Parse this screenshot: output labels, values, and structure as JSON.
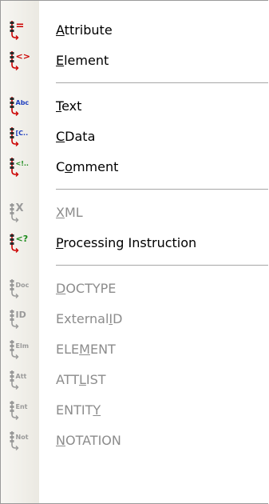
{
  "menu": {
    "items": [
      {
        "label_before": "",
        "accel": "A",
        "label_after": "ttribute",
        "icon": "attribute-icon",
        "badge": "=",
        "enabled": true
      },
      {
        "label_before": "",
        "accel": "E",
        "label_after": "lement",
        "icon": "element-icon",
        "badge": "<>",
        "enabled": true
      },
      {
        "label_before": "",
        "accel": "T",
        "label_after": "ext",
        "icon": "text-icon",
        "badge": "Abc",
        "enabled": true
      },
      {
        "label_before": "",
        "accel": "C",
        "label_after": "Data",
        "icon": "cdata-icon",
        "badge": "[C..",
        "enabled": true
      },
      {
        "label_before": "C",
        "accel": "o",
        "label_after": "mment",
        "icon": "comment-icon",
        "badge": "<!..",
        "enabled": true
      },
      {
        "label_before": "",
        "accel": "X",
        "label_after": "ML",
        "icon": "xml-icon",
        "badge": "X",
        "enabled": false
      },
      {
        "label_before": "",
        "accel": "P",
        "label_after": "rocessing Instruction",
        "icon": "processing-instruction-icon",
        "badge": "<?",
        "enabled": true
      },
      {
        "label_before": "",
        "accel": "D",
        "label_after": "OCTYPE",
        "icon": "doctype-icon",
        "badge": "Doc",
        "enabled": false
      },
      {
        "label_before": "External",
        "accel": "I",
        "label_after": "D",
        "icon": "external-id-icon",
        "badge": "ID",
        "enabled": false
      },
      {
        "label_before": "ELE",
        "accel": "M",
        "label_after": "ENT",
        "icon": "element-decl-icon",
        "badge": "Elm",
        "enabled": false
      },
      {
        "label_before": "ATT",
        "accel": "L",
        "label_after": "IST",
        "icon": "attlist-icon",
        "badge": "Att",
        "enabled": false
      },
      {
        "label_before": "ENTIT",
        "accel": "Y",
        "label_after": "",
        "icon": "entity-icon",
        "badge": "Ent",
        "enabled": false
      },
      {
        "label_before": "",
        "accel": "N",
        "label_after": "OTATION",
        "icon": "notation-icon",
        "badge": "Not",
        "enabled": false
      }
    ]
  },
  "colors": {
    "enabled_text": "#000000",
    "disabled_text": "#8c8c8c",
    "node_red": "#cc0000",
    "node_blue": "#1f3fbf",
    "node_green": "#1a8a1a",
    "node_dark": "#222222",
    "disabled_icon": "#9a9a9a"
  }
}
